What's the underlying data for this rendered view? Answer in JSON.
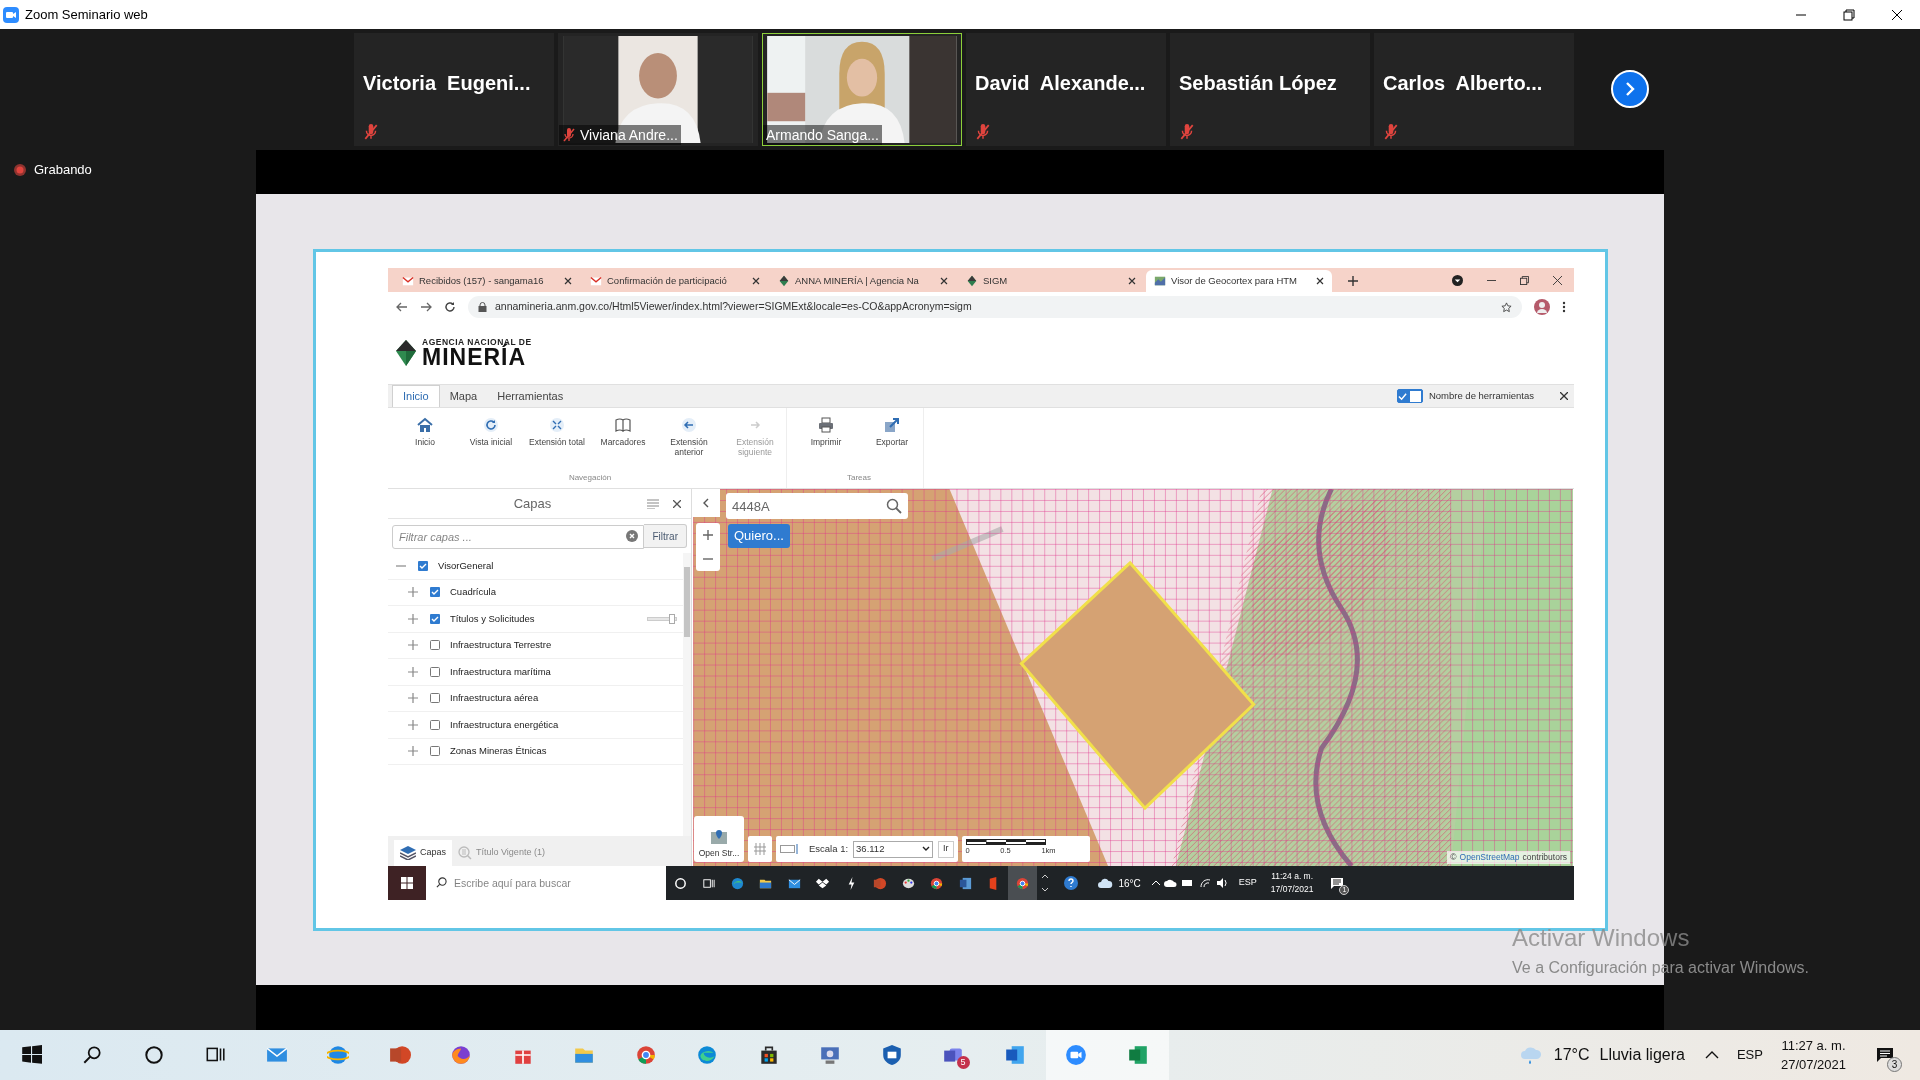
{
  "window": {
    "title": "Zoom Seminario web"
  },
  "participants": [
    {
      "name": "Victoria  Eugeni...",
      "kind": "name",
      "muted": true,
      "speaking": false
    },
    {
      "name": "Viviana Andre...",
      "kind": "video",
      "muted": true,
      "speaking": false
    },
    {
      "name": "Armando Sanga...",
      "kind": "video",
      "muted": false,
      "speaking": true
    },
    {
      "name": "David  Alexande...",
      "kind": "name",
      "muted": true,
      "speaking": false
    },
    {
      "name": "Sebastián López",
      "kind": "name",
      "muted": true,
      "speaking": false
    },
    {
      "name": "Carlos  Alberto...",
      "kind": "name",
      "muted": true,
      "speaking": false
    }
  ],
  "recording": {
    "label": "Grabando"
  },
  "browser": {
    "tabs": [
      {
        "title": "Recibidos (157) - sangama16",
        "kind": "mail",
        "selected": false
      },
      {
        "title": "Confirmación de participació",
        "kind": "mail",
        "selected": false
      },
      {
        "title": "ANNA MINERÍA | Agencia Na",
        "kind": "gem",
        "selected": false
      },
      {
        "title": "SIGM",
        "kind": "gem",
        "selected": false
      },
      {
        "title": "Visor de Geocortex para HTM",
        "kind": "map",
        "selected": true
      }
    ],
    "url": "annamineria.anm.gov.co/Html5Viewer/index.html?viewer=SIGMExt&locale=es-CO&appAcronym=sigm"
  },
  "app": {
    "logo_top": "AGENCIA NACIONAL DE",
    "logo_main": "MINERÍA",
    "ribbon_tabs": [
      {
        "label": "Inicio",
        "selected": true
      },
      {
        "label": "Mapa",
        "selected": false
      },
      {
        "label": "Herramientas",
        "selected": false
      }
    ],
    "tool_names_toggle": {
      "label": "Nombre de herramientas",
      "on": true
    },
    "tool_groups": [
      {
        "label": "Navegación",
        "tools": [
          {
            "label": "Inicio",
            "kind": "home",
            "disabled": false
          },
          {
            "label": "Vista inicial",
            "kind": "refresh",
            "disabled": false
          },
          {
            "label": "Extensión total",
            "kind": "expand",
            "disabled": false
          },
          {
            "label": "Marcadores",
            "kind": "book",
            "disabled": false
          },
          {
            "label": "Extensión anterior",
            "kind": "back",
            "disabled": false
          },
          {
            "label": "Extensión siguiente",
            "kind": "forward",
            "disabled": true
          }
        ]
      },
      {
        "label": "Tareas",
        "tools": [
          {
            "label": "Imprimir",
            "kind": "print",
            "disabled": false
          },
          {
            "label": "Exportar",
            "kind": "export",
            "disabled": false
          }
        ]
      }
    ],
    "layers_panel": {
      "title": "Capas",
      "filter_placeholder": "Filtrar capas ...",
      "filter_button": "Filtrar",
      "layers": [
        {
          "label": "VisorGeneral",
          "checked": true,
          "expanded": true,
          "children": [
            {
              "label": "Cuadrícula",
              "checked": true,
              "expanded": false
            },
            {
              "label": "Títulos y Solicitudes",
              "checked": true,
              "expanded": false,
              "level": 0.85
            },
            {
              "label": "Infraestructura Terrestre",
              "checked": false,
              "expanded": false
            },
            {
              "label": "Infraestructura marítima",
              "checked": false,
              "expanded": false
            },
            {
              "label": "Infraestructura aérea",
              "checked": false,
              "expanded": false
            },
            {
              "label": "Infraestructura energética",
              "checked": false,
              "expanded": false
            },
            {
              "label": "Zonas Mineras Étnicas",
              "checked": false,
              "expanded": false
            }
          ]
        }
      ],
      "bottom_tabs": [
        {
          "label": "Capas",
          "selected": true
        },
        {
          "label": "Título Vigente (1)",
          "selected": false
        }
      ]
    },
    "map": {
      "kind": "picture",
      "search_value": "4448A",
      "quick_button": "Quiero...",
      "basemap_button": "Open Str...",
      "scale_label": "Escala 1:",
      "scale_value": "36.112",
      "go_button": "Ir",
      "scale_bar": [
        "0",
        "0.5",
        "1km"
      ],
      "attribution_mark": "©",
      "attribution_link": "OpenStreetMap",
      "attribution_text": "contributors"
    },
    "inner_taskbar": {
      "search_placeholder": "Escribe aquí para buscar",
      "temperature": "16°C",
      "language": "ESP",
      "time": "11:24 a. m.",
      "date": "17/07/2021",
      "notifications": "1"
    }
  },
  "activation_notice": {
    "title": "Activar Windows",
    "text": "Ve a Configuración para activar Windows."
  },
  "taskbar": {
    "badge": "5",
    "temperature": "17°C",
    "condition": "Lluvia ligera",
    "language": "ESP",
    "time": "11:27 a. m.",
    "date": "27/07/2021",
    "notifications": "3"
  }
}
